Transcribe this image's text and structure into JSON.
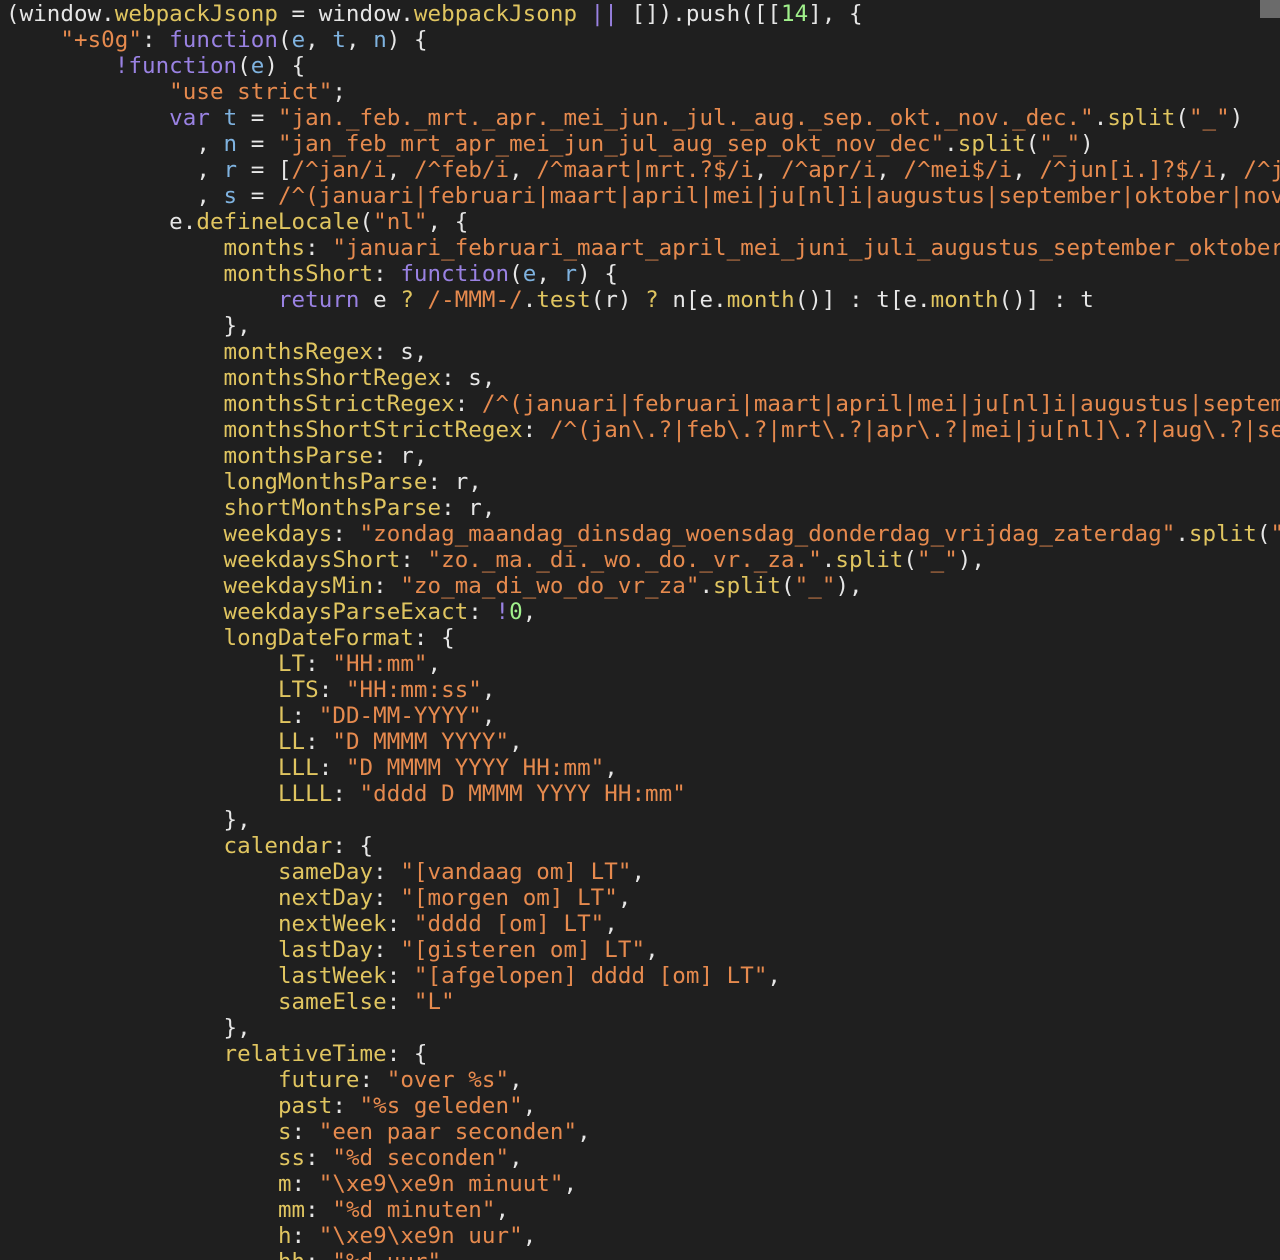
{
  "editor": {
    "colors": {
      "background": "#1f1f1f",
      "plain": "#e6e6e6",
      "keyword": "#9a82e3",
      "string": "#e68a4e",
      "number": "#a0f08b",
      "property": "#e0c560",
      "param": "#7fb3e0"
    },
    "lines": [
      [
        [
          "p",
          "(window."
        ],
        [
          "y",
          "webpackJsonp"
        ],
        [
          "p",
          " = window."
        ],
        [
          "y",
          "webpackJsonp"
        ],
        [
          "p",
          " "
        ],
        [
          "k",
          "||"
        ],
        [
          "p",
          " []).push([["
        ],
        [
          "n",
          "14"
        ],
        [
          "p",
          "], {"
        ]
      ],
      [
        [
          "p",
          "    "
        ],
        [
          "s",
          "\"+s0g\""
        ],
        [
          "p",
          ": "
        ],
        [
          "k",
          "function"
        ],
        [
          "p",
          "("
        ],
        [
          "b",
          "e"
        ],
        [
          "p",
          ", "
        ],
        [
          "b",
          "t"
        ],
        [
          "p",
          ", "
        ],
        [
          "b",
          "n"
        ],
        [
          "p",
          ") {"
        ]
      ],
      [
        [
          "p",
          "        "
        ],
        [
          "k",
          "!function"
        ],
        [
          "p",
          "("
        ],
        [
          "b",
          "e"
        ],
        [
          "p",
          ") {"
        ]
      ],
      [
        [
          "p",
          "            "
        ],
        [
          "s",
          "\"use strict\""
        ],
        [
          "p",
          ";"
        ]
      ],
      [
        [
          "p",
          "            "
        ],
        [
          "k",
          "var"
        ],
        [
          "p",
          " "
        ],
        [
          "b",
          "t"
        ],
        [
          "p",
          " = "
        ],
        [
          "s",
          "\"jan._feb._mrt._apr._mei_jun._jul._aug._sep._okt._nov._dec.\""
        ],
        [
          "p",
          "."
        ],
        [
          "y",
          "split"
        ],
        [
          "p",
          "("
        ],
        [
          "s",
          "\"_\""
        ],
        [
          "p",
          ")"
        ]
      ],
      [
        [
          "p",
          "              , "
        ],
        [
          "b",
          "n"
        ],
        [
          "p",
          " = "
        ],
        [
          "s",
          "\"jan_feb_mrt_apr_mei_jun_jul_aug_sep_okt_nov_dec\""
        ],
        [
          "p",
          "."
        ],
        [
          "y",
          "split"
        ],
        [
          "p",
          "("
        ],
        [
          "s",
          "\"_\""
        ],
        [
          "p",
          ")"
        ]
      ],
      [
        [
          "p",
          "              , "
        ],
        [
          "b",
          "r"
        ],
        [
          "p",
          " = ["
        ],
        [
          "s",
          "/^jan/i"
        ],
        [
          "p",
          ", "
        ],
        [
          "s",
          "/^feb/i"
        ],
        [
          "p",
          ", "
        ],
        [
          "s",
          "/^maart|mrt.?$/i"
        ],
        [
          "p",
          ", "
        ],
        [
          "s",
          "/^apr/i"
        ],
        [
          "p",
          ", "
        ],
        [
          "s",
          "/^mei$/i"
        ],
        [
          "p",
          ", "
        ],
        [
          "s",
          "/^jun[i.]?$/i"
        ],
        [
          "p",
          ", "
        ],
        [
          "s",
          "/^jul|"
        ]
      ],
      [
        [
          "p",
          "              , "
        ],
        [
          "b",
          "s"
        ],
        [
          "p",
          " = "
        ],
        [
          "s",
          "/^(januari|februari|maart|april|mei|ju[nl]i|augustus|september|oktober|novemb"
        ]
      ],
      [
        [
          "p",
          "            e."
        ],
        [
          "y",
          "defineLocale"
        ],
        [
          "p",
          "("
        ],
        [
          "s",
          "\"nl\""
        ],
        [
          "p",
          ", {"
        ]
      ],
      [
        [
          "p",
          "                "
        ],
        [
          "y",
          "months"
        ],
        [
          "p",
          ": "
        ],
        [
          "s",
          "\"januari_februari_maart_april_mei_juni_juli_augustus_september_oktober_no"
        ]
      ],
      [
        [
          "p",
          "                "
        ],
        [
          "y",
          "monthsShort"
        ],
        [
          "p",
          ": "
        ],
        [
          "k",
          "function"
        ],
        [
          "p",
          "("
        ],
        [
          "b",
          "e"
        ],
        [
          "p",
          ", "
        ],
        [
          "b",
          "r"
        ],
        [
          "p",
          ") {"
        ]
      ],
      [
        [
          "p",
          "                    "
        ],
        [
          "k",
          "return"
        ],
        [
          "p",
          " e "
        ],
        [
          "y",
          "?"
        ],
        [
          "p",
          " "
        ],
        [
          "s",
          "/-MMM-/"
        ],
        [
          "p",
          "."
        ],
        [
          "y",
          "test"
        ],
        [
          "p",
          "(r) "
        ],
        [
          "y",
          "?"
        ],
        [
          "p",
          " n[e."
        ],
        [
          "y",
          "month"
        ],
        [
          "p",
          "()] : t[e."
        ],
        [
          "y",
          "month"
        ],
        [
          "p",
          "()] : t"
        ]
      ],
      [
        [
          "p",
          "                },"
        ]
      ],
      [
        [
          "p",
          "                "
        ],
        [
          "y",
          "monthsRegex"
        ],
        [
          "p",
          ": s,"
        ]
      ],
      [
        [
          "p",
          "                "
        ],
        [
          "y",
          "monthsShortRegex"
        ],
        [
          "p",
          ": s,"
        ]
      ],
      [
        [
          "p",
          "                "
        ],
        [
          "y",
          "monthsStrictRegex"
        ],
        [
          "p",
          ": "
        ],
        [
          "s",
          "/^(januari|februari|maart|april|mei|ju[nl]i|augustus|september"
        ]
      ],
      [
        [
          "p",
          "                "
        ],
        [
          "y",
          "monthsShortStrictRegex"
        ],
        [
          "p",
          ": "
        ],
        [
          "s",
          "/^(jan\\.?|feb\\.?|mrt\\.?|apr\\.?|mei|ju[nl]\\.?|aug\\.?|sep\\."
        ]
      ],
      [
        [
          "p",
          "                "
        ],
        [
          "y",
          "monthsParse"
        ],
        [
          "p",
          ": r,"
        ]
      ],
      [
        [
          "p",
          "                "
        ],
        [
          "y",
          "longMonthsParse"
        ],
        [
          "p",
          ": r,"
        ]
      ],
      [
        [
          "p",
          "                "
        ],
        [
          "y",
          "shortMonthsParse"
        ],
        [
          "p",
          ": r,"
        ]
      ],
      [
        [
          "p",
          "                "
        ],
        [
          "y",
          "weekdays"
        ],
        [
          "p",
          ": "
        ],
        [
          "s",
          "\"zondag_maandag_dinsdag_woensdag_donderdag_vrijdag_zaterdag\""
        ],
        [
          "p",
          "."
        ],
        [
          "y",
          "split"
        ],
        [
          "p",
          "("
        ],
        [
          "s",
          "\"_\""
        ],
        [
          "p",
          ")"
        ]
      ],
      [
        [
          "p",
          "                "
        ],
        [
          "y",
          "weekdaysShort"
        ],
        [
          "p",
          ": "
        ],
        [
          "s",
          "\"zo._ma._di._wo._do._vr._za.\""
        ],
        [
          "p",
          "."
        ],
        [
          "y",
          "split"
        ],
        [
          "p",
          "("
        ],
        [
          "s",
          "\"_\""
        ],
        [
          "p",
          "),"
        ]
      ],
      [
        [
          "p",
          "                "
        ],
        [
          "y",
          "weekdaysMin"
        ],
        [
          "p",
          ": "
        ],
        [
          "s",
          "\"zo_ma_di_wo_do_vr_za\""
        ],
        [
          "p",
          "."
        ],
        [
          "y",
          "split"
        ],
        [
          "p",
          "("
        ],
        [
          "s",
          "\"_\""
        ],
        [
          "p",
          "),"
        ]
      ],
      [
        [
          "p",
          "                "
        ],
        [
          "y",
          "weekdaysParseExact"
        ],
        [
          "p",
          ": "
        ],
        [
          "k",
          "!"
        ],
        [
          "n",
          "0"
        ],
        [
          "p",
          ","
        ]
      ],
      [
        [
          "p",
          "                "
        ],
        [
          "y",
          "longDateFormat"
        ],
        [
          "p",
          ": {"
        ]
      ],
      [
        [
          "p",
          "                    "
        ],
        [
          "y",
          "LT"
        ],
        [
          "p",
          ": "
        ],
        [
          "s",
          "\"HH:mm\""
        ],
        [
          "p",
          ","
        ]
      ],
      [
        [
          "p",
          "                    "
        ],
        [
          "y",
          "LTS"
        ],
        [
          "p",
          ": "
        ],
        [
          "s",
          "\"HH:mm:ss\""
        ],
        [
          "p",
          ","
        ]
      ],
      [
        [
          "p",
          "                    "
        ],
        [
          "y",
          "L"
        ],
        [
          "p",
          ": "
        ],
        [
          "s",
          "\"DD-MM-YYYY\""
        ],
        [
          "p",
          ","
        ]
      ],
      [
        [
          "p",
          "                    "
        ],
        [
          "y",
          "LL"
        ],
        [
          "p",
          ": "
        ],
        [
          "s",
          "\"D MMMM YYYY\""
        ],
        [
          "p",
          ","
        ]
      ],
      [
        [
          "p",
          "                    "
        ],
        [
          "y",
          "LLL"
        ],
        [
          "p",
          ": "
        ],
        [
          "s",
          "\"D MMMM YYYY HH:mm\""
        ],
        [
          "p",
          ","
        ]
      ],
      [
        [
          "p",
          "                    "
        ],
        [
          "y",
          "LLLL"
        ],
        [
          "p",
          ": "
        ],
        [
          "s",
          "\"dddd D MMMM YYYY HH:mm\""
        ]
      ],
      [
        [
          "p",
          "                },"
        ]
      ],
      [
        [
          "p",
          "                "
        ],
        [
          "y",
          "calendar"
        ],
        [
          "p",
          ": {"
        ]
      ],
      [
        [
          "p",
          "                    "
        ],
        [
          "y",
          "sameDay"
        ],
        [
          "p",
          ": "
        ],
        [
          "s",
          "\"[vandaag om] LT\""
        ],
        [
          "p",
          ","
        ]
      ],
      [
        [
          "p",
          "                    "
        ],
        [
          "y",
          "nextDay"
        ],
        [
          "p",
          ": "
        ],
        [
          "s",
          "\"[morgen om] LT\""
        ],
        [
          "p",
          ","
        ]
      ],
      [
        [
          "p",
          "                    "
        ],
        [
          "y",
          "nextWeek"
        ],
        [
          "p",
          ": "
        ],
        [
          "s",
          "\"dddd [om] LT\""
        ],
        [
          "p",
          ","
        ]
      ],
      [
        [
          "p",
          "                    "
        ],
        [
          "y",
          "lastDay"
        ],
        [
          "p",
          ": "
        ],
        [
          "s",
          "\"[gisteren om] LT\""
        ],
        [
          "p",
          ","
        ]
      ],
      [
        [
          "p",
          "                    "
        ],
        [
          "y",
          "lastWeek"
        ],
        [
          "p",
          ": "
        ],
        [
          "s",
          "\"[afgelopen] dddd [om] LT\""
        ],
        [
          "p",
          ","
        ]
      ],
      [
        [
          "p",
          "                    "
        ],
        [
          "y",
          "sameElse"
        ],
        [
          "p",
          ": "
        ],
        [
          "s",
          "\"L\""
        ]
      ],
      [
        [
          "p",
          "                },"
        ]
      ],
      [
        [
          "p",
          "                "
        ],
        [
          "y",
          "relativeTime"
        ],
        [
          "p",
          ": {"
        ]
      ],
      [
        [
          "p",
          "                    "
        ],
        [
          "y",
          "future"
        ],
        [
          "p",
          ": "
        ],
        [
          "s",
          "\"over %s\""
        ],
        [
          "p",
          ","
        ]
      ],
      [
        [
          "p",
          "                    "
        ],
        [
          "y",
          "past"
        ],
        [
          "p",
          ": "
        ],
        [
          "s",
          "\"%s geleden\""
        ],
        [
          "p",
          ","
        ]
      ],
      [
        [
          "p",
          "                    "
        ],
        [
          "y",
          "s"
        ],
        [
          "p",
          ": "
        ],
        [
          "s",
          "\"een paar seconden\""
        ],
        [
          "p",
          ","
        ]
      ],
      [
        [
          "p",
          "                    "
        ],
        [
          "y",
          "ss"
        ],
        [
          "p",
          ": "
        ],
        [
          "s",
          "\"%d seconden\""
        ],
        [
          "p",
          ","
        ]
      ],
      [
        [
          "p",
          "                    "
        ],
        [
          "y",
          "m"
        ],
        [
          "p",
          ": "
        ],
        [
          "s",
          "\"\\xe9\\xe9n minuut\""
        ],
        [
          "p",
          ","
        ]
      ],
      [
        [
          "p",
          "                    "
        ],
        [
          "y",
          "mm"
        ],
        [
          "p",
          ": "
        ],
        [
          "s",
          "\"%d minuten\""
        ],
        [
          "p",
          ","
        ]
      ],
      [
        [
          "p",
          "                    "
        ],
        [
          "y",
          "h"
        ],
        [
          "p",
          ": "
        ],
        [
          "s",
          "\"\\xe9\\xe9n uur\""
        ],
        [
          "p",
          ","
        ]
      ],
      [
        [
          "p",
          "                    "
        ],
        [
          "y",
          "hh"
        ],
        [
          "p",
          ": "
        ],
        [
          "s",
          "\"%d uur\""
        ],
        [
          "p",
          ","
        ]
      ]
    ]
  }
}
